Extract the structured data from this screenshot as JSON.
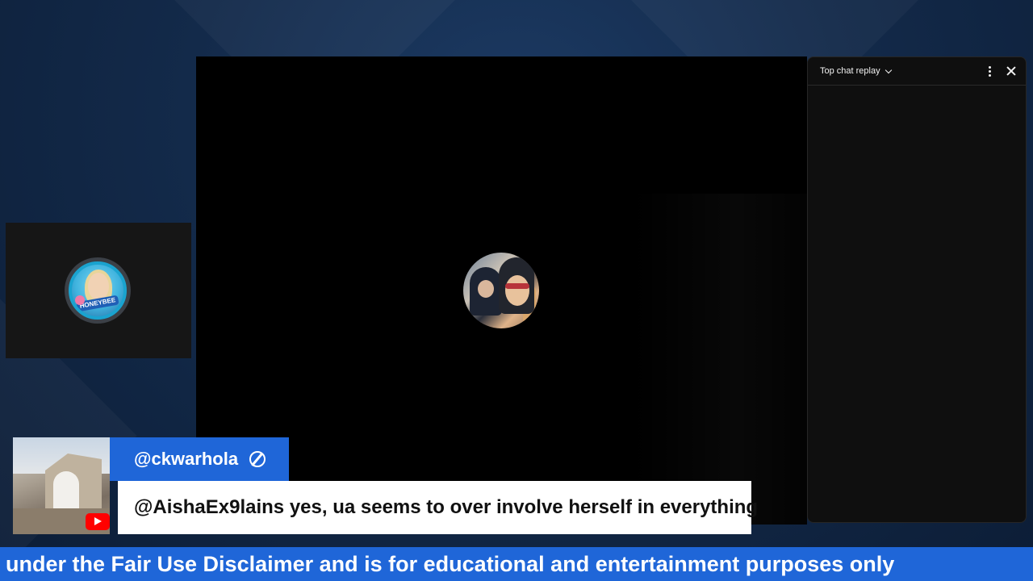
{
  "chat": {
    "title": "Top chat replay",
    "icons": [
      "chevron-down-icon",
      "more-vert-icon",
      "close-icon"
    ]
  },
  "lower_third": {
    "username": "@ckwarhola",
    "message": "@AishaEx9lains yes, ua seems to over involve herself in everything",
    "brand_logo": "youtube-logo",
    "accent_color": "#1f66d8"
  },
  "ticker": {
    "text": "under the Fair Use Disclaimer and is for educational and entertainment purposes only"
  },
  "side_tile": {
    "badge": "HONEYBEE"
  }
}
